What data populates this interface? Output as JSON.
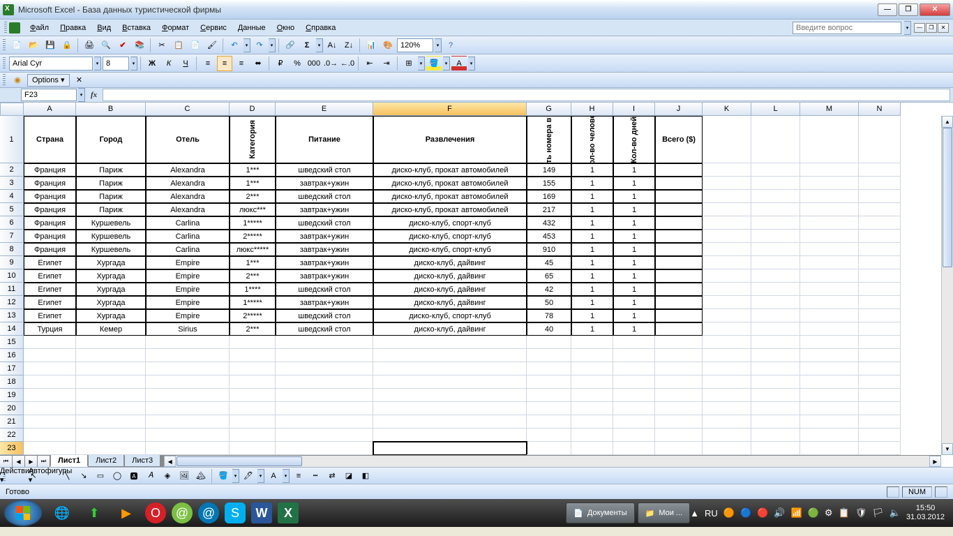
{
  "title": "Microsoft Excel - База данных туристической фирмы",
  "menubar": {
    "items": [
      "Файл",
      "Правка",
      "Вид",
      "Вставка",
      "Формат",
      "Сервис",
      "Данные",
      "Окно",
      "Справка"
    ],
    "question_placeholder": "Введите вопрос"
  },
  "formatting": {
    "font_name": "Arial Cyr",
    "font_size": "8",
    "zoom": "120%"
  },
  "options_bar": {
    "options_label": "Options ▾"
  },
  "namebox": "F23",
  "columns": {
    "letters": [
      "A",
      "B",
      "C",
      "D",
      "E",
      "F",
      "G",
      "H",
      "I",
      "J",
      "K",
      "L",
      "M",
      "N"
    ],
    "widths": [
      75,
      100,
      120,
      66,
      140,
      220,
      64,
      60,
      60,
      68,
      70,
      70,
      84,
      60
    ],
    "selected_index": 5
  },
  "row_heights": {
    "header": 68,
    "data": 19
  },
  "visible_rows": 23,
  "selected_row": 23,
  "headers": [
    "Страна",
    "Город",
    "Отель",
    "Категория",
    "Питание",
    "Развлечения",
    "Стоимость номера в сутки ($)",
    "Кол-во человек",
    "Кол-во дней",
    "Всего ($)"
  ],
  "vertical_headers": [
    false,
    false,
    false,
    true,
    false,
    false,
    true,
    true,
    true,
    false
  ],
  "data_cols_bordered": 10,
  "data": [
    [
      "Франция",
      "Париж",
      "Alexandra",
      "1***",
      "шведский стол",
      "диско-клуб, прокат автомобилей",
      "149",
      "1",
      "1",
      ""
    ],
    [
      "Франция",
      "Париж",
      "Alexandra",
      "1***",
      "завтрак+ужин",
      "диско-клуб, прокат автомобилей",
      "155",
      "1",
      "1",
      ""
    ],
    [
      "Франция",
      "Париж",
      "Alexandra",
      "2***",
      "шведский стол",
      "диско-клуб, прокат автомобилей",
      "169",
      "1",
      "1",
      ""
    ],
    [
      "Франция",
      "Париж",
      "Alexandra",
      "люкс***",
      "завтрак+ужин",
      "диско-клуб, прокат автомобилей",
      "217",
      "1",
      "1",
      ""
    ],
    [
      "Франция",
      "Куршевель",
      "Carlina",
      "1*****",
      "шведский стол",
      "диско-клуб, спорт-клуб",
      "432",
      "1",
      "1",
      ""
    ],
    [
      "Франция",
      "Куршевель",
      "Carlina",
      "2*****",
      "завтрак+ужин",
      "диско-клуб, спорт-клуб",
      "453",
      "1",
      "1",
      ""
    ],
    [
      "Франция",
      "Куршевель",
      "Carlina",
      "люкс*****",
      "завтрак+ужин",
      "диско-клуб, спорт-клуб",
      "910",
      "1",
      "1",
      ""
    ],
    [
      "Египет",
      "Хургада",
      "Empire",
      "1***",
      "завтрак+ужин",
      "диско-клуб, дайвинг",
      "45",
      "1",
      "1",
      ""
    ],
    [
      "Египет",
      "Хургада",
      "Empire",
      "2***",
      "завтрак+ужин",
      "диско-клуб, дайвинг",
      "65",
      "1",
      "1",
      ""
    ],
    [
      "Египет",
      "Хургада",
      "Empire",
      "1****",
      "шведский стол",
      "диско-клуб, дайвинг",
      "42",
      "1",
      "1",
      ""
    ],
    [
      "Египет",
      "Хургада",
      "Empire",
      "1*****",
      "завтрак+ужин",
      "диско-клуб, дайвинг",
      "50",
      "1",
      "1",
      ""
    ],
    [
      "Египет",
      "Хургада",
      "Empire",
      "2*****",
      "шведский стол",
      "диско-клуб, спорт-клуб",
      "78",
      "1",
      "1",
      ""
    ],
    [
      "Турция",
      "Кемер",
      "Sirius",
      "2***",
      "шведский стол",
      "диско-клуб, дайвинг",
      "40",
      "1",
      "1",
      ""
    ]
  ],
  "sheets": {
    "active": "Лист1",
    "tabs": [
      "Лист1",
      "Лист2",
      "Лист3"
    ]
  },
  "drawing_bar": {
    "actions": "Действия ▾",
    "autoshapes": "Автофигуры ▾"
  },
  "status": {
    "ready": "Готово",
    "num": "NUM"
  },
  "taskbar": {
    "lang": "RU",
    "time": "15:50",
    "date": "31.03.2012",
    "doc_label": "Документы",
    "folder_label": "Мои ..."
  }
}
